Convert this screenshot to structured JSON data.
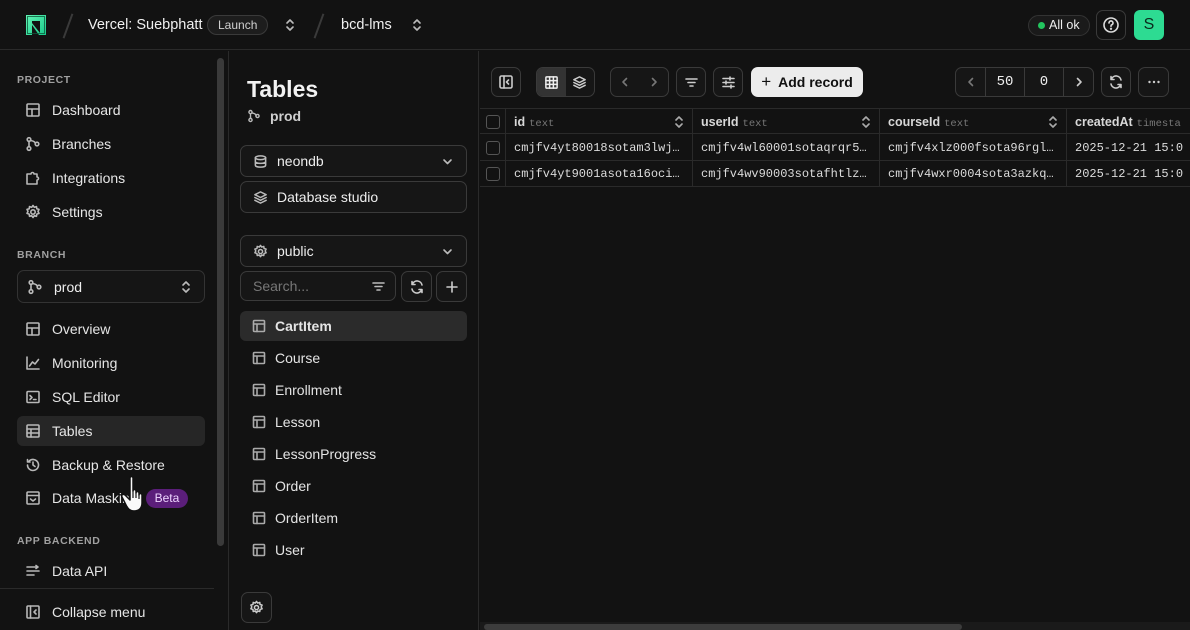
{
  "topbar": {
    "project_name": "Vercel: Suebphatt",
    "plan_badge": "Launch",
    "branch": "bcd-lms",
    "status": "All ok",
    "avatar_initial": "S",
    "status_color": "#22c55e",
    "accent_color": "#2ddb92"
  },
  "sidebar": {
    "project_label": "PROJECT",
    "project_items": [
      {
        "label": "Dashboard",
        "icon": "dashboard-icon"
      },
      {
        "label": "Branches",
        "icon": "branch-icon"
      },
      {
        "label": "Integrations",
        "icon": "puzzle-icon"
      },
      {
        "label": "Settings",
        "icon": "gear-icon"
      }
    ],
    "branch_label": "BRANCH",
    "branch_selected": "prod",
    "branch_items": [
      {
        "label": "Overview",
        "icon": "grid-icon"
      },
      {
        "label": "Monitoring",
        "icon": "chart-icon"
      },
      {
        "label": "SQL Editor",
        "icon": "terminal-icon"
      },
      {
        "label": "Tables",
        "icon": "table-icon",
        "active": true
      },
      {
        "label": "Backup & Restore",
        "icon": "history-icon"
      },
      {
        "label": "Data Masking",
        "icon": "mask-icon",
        "badge": "Beta"
      }
    ],
    "backend_label": "APP BACKEND",
    "backend_items": [
      {
        "label": "Data API",
        "icon": "api-icon"
      }
    ],
    "collapse_label": "Collapse menu"
  },
  "tables_panel": {
    "title": "Tables",
    "branch": "prod",
    "database": "neondb",
    "studio_label": "Database studio",
    "schema": "public",
    "search_placeholder": "Search...",
    "tables": [
      "CartItem",
      "Course",
      "Enrollment",
      "Lesson",
      "LessonProgress",
      "Order",
      "OrderItem",
      "User"
    ],
    "active_table": "CartItem"
  },
  "toolbar": {
    "add_record_label": "Add record",
    "page_size": "50",
    "offset": "0"
  },
  "grid": {
    "columns": [
      {
        "name": "id",
        "type": "text"
      },
      {
        "name": "userId",
        "type": "text"
      },
      {
        "name": "courseId",
        "type": "text"
      },
      {
        "name": "createdAt",
        "type": "timesta"
      }
    ],
    "rows": [
      [
        "cmjfv4yt80018sotam3lwj…",
        "cmjfv4wl60001sotaqrqr5…",
        "cmjfv4xlz000fsota96rgl…",
        "2025-12-21 15:0"
      ],
      [
        "cmjfv4yt9001asota16oci…",
        "cmjfv4wv90003sotafhtlz…",
        "cmjfv4wxr0004sota3azkq…",
        "2025-12-21 15:0"
      ]
    ]
  }
}
